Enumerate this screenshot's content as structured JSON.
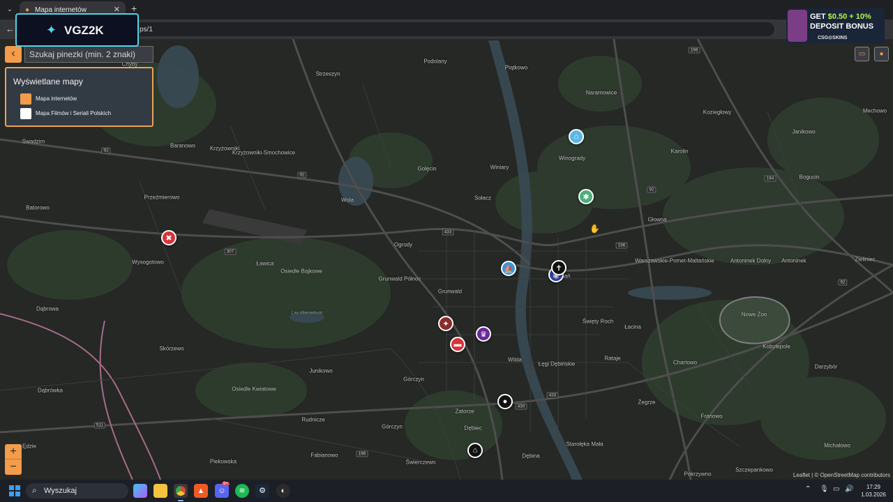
{
  "browser": {
    "tab_title": "Mapa internetów",
    "tab_favicon_icon": "map-pin-icon",
    "url_fragment": "ps/1"
  },
  "search": {
    "placeholder": "Szukaj pinezki (min. 2 znaki)"
  },
  "layers": {
    "title": "Wyświetlane mapy",
    "items": [
      {
        "label": "Mapa internetów",
        "color": "#f39c4a"
      },
      {
        "label": "Mapa Filmów i Seriali Polskich",
        "color": "#ffffff"
      }
    ]
  },
  "zoom": {
    "in_label": "+",
    "out_label": "−"
  },
  "attribution": "Leaflet | © OpenStreetMap contributors",
  "places": [
    "Chyby",
    "Podolany",
    "Piątkowo",
    "Strzeszyn",
    "Naramowice",
    "Koziegłowy",
    "Mechowo",
    "Swadzim",
    "Baranowo",
    "Krzyżowniki",
    "Krzyżowniki-Smochowice",
    "Golęcin",
    "Winiary",
    "Winogrady",
    "Karolin",
    "Janikowo",
    "Batorowo",
    "Przeźmierowo",
    "Wola",
    "Sołacz",
    "Bogucin",
    "Głowna",
    "Ogrody",
    "Ławica",
    "Osiedle Bajkowe",
    "Wysogotowo",
    "Grunwald Północ",
    "Grunwald",
    "Warszawskie-Pomet-Maltańskie",
    "Antoninek Dolny",
    "Antoninek",
    "Zieliniec",
    "Nowe Zoo",
    "Święty Roch",
    "Łacina",
    "Rataje",
    "Chartowo",
    "Kobylepole",
    "Dąbrowa",
    "Skórzewo",
    "Junikowo",
    "Łęgi Dębińskie",
    "Wilda",
    "Górczyn",
    "Osiedle Kwiatowe",
    "Darzybór",
    "Dąbrówka",
    "Zatorze",
    "Żegrze",
    "Franowo",
    "Rudnicze",
    "Górczyn",
    "Dębiec",
    "Starołęka Mała",
    "Michałowo",
    "Fabianowo",
    "Świerczewo",
    "Dębina",
    "Piekowska",
    "Szczepankowo",
    "Pokrzywno",
    "Ędzie",
    "Poznań",
    "Las Marcelinski"
  ],
  "roads": [
    "196",
    "92",
    "92",
    "92",
    "307",
    "433",
    "194",
    "92",
    "196",
    "430",
    "511",
    "196",
    "433"
  ],
  "pins": [
    {
      "icon": "home-icon",
      "color": "#5bb7e6"
    },
    {
      "icon": "paw-icon",
      "color": "#4caf7d"
    },
    {
      "icon": "car-crash-icon",
      "color": "#d8323c"
    },
    {
      "icon": "boat-icon",
      "color": "#3c95d6"
    },
    {
      "icon": "cross-icon",
      "color": "#111111"
    },
    {
      "icon": "target-icon",
      "color": "#2b3fa0"
    },
    {
      "icon": "running-icon",
      "color": "#8b2c2c"
    },
    {
      "icon": "car-icon",
      "color": "#d8323c"
    },
    {
      "icon": "chess-icon",
      "color": "#6a2a9a"
    },
    {
      "icon": "disc-icon",
      "color": "#111111"
    },
    {
      "icon": "building-icon",
      "color": "#111111"
    }
  ],
  "overlay": {
    "vgz_text": "VGZ2K",
    "ad_line1_prefix": "GET ",
    "ad_line1_accent": "$0.50 + 10%",
    "ad_line2": "DEPOSIT BONUS",
    "ad_line3": "CSG⊙SKINS"
  },
  "taskbar": {
    "search_text": "Wyszukaj",
    "apps": [
      "copilot-icon",
      "file-explorer-icon",
      "chrome-icon",
      "brave-icon",
      "discord-icon",
      "spotify-icon",
      "steam-icon",
      "app-icon"
    ],
    "discord_badge": "9+",
    "time": "17:29",
    "date": "1.03.2026"
  }
}
